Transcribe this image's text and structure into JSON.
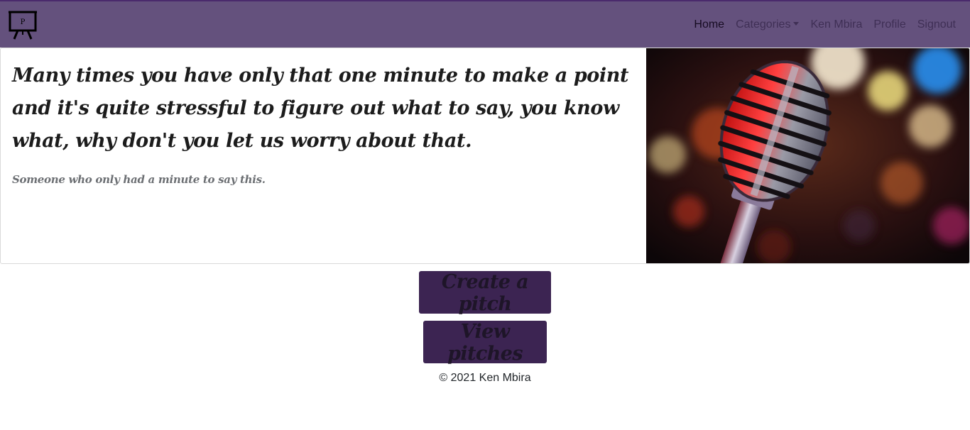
{
  "navbar": {
    "brand_icon": "presentation-board-icon",
    "brand_letter": "P",
    "links": [
      "Home",
      "Categories",
      "Ken Mbira",
      "Profile",
      "Signout"
    ]
  },
  "hero": {
    "quote": "Many times you have only that one minute to make a point and it's quite stressful to figure out what to say, you know what, why don't you let us worry about that.",
    "attribution": "Someone who only had a minute to say this.",
    "image": "microphone-photo"
  },
  "actions": {
    "create_label": "Create a pitch",
    "view_label": "View pitches"
  },
  "footer": {
    "text": "© 2021 Ken Mbira"
  },
  "colors": {
    "navbar": "#64517d",
    "button": "#3c2452"
  }
}
